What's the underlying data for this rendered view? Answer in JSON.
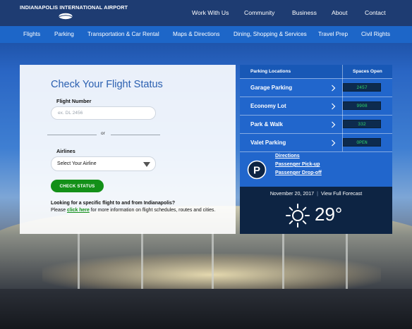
{
  "header": {
    "logo_text": "INDIANAPOLIS INTERNATIONAL AIRPORT",
    "nav": [
      "Work With Us",
      "Community",
      "Business",
      "About",
      "Contact"
    ]
  },
  "subnav": [
    "Flights",
    "Parking",
    "Transportation & Car Rental",
    "Maps & Directions",
    "Dining, Shopping & Services",
    "Travel Prep",
    "Civil Rights"
  ],
  "flight_status": {
    "title": "Check Your Flight Status",
    "flight_number_label": "Flight Number",
    "flight_number_placeholder": "ex. DL 2456",
    "flight_number_value": "",
    "or_text": "or",
    "airlines_label": "Airlines",
    "airline_selected": "Select Your Airline",
    "check_button": "CHECK STATUS",
    "note_heading": "Looking for a specific flight to and from Indianapolis?",
    "note_prefix": "Please ",
    "note_link": "click here",
    "note_suffix": " for more information on flight schedules, routes and cities."
  },
  "parking": {
    "col_locations": "Parking Locations",
    "col_spaces": "Spaces Open",
    "rows": [
      {
        "name": "Garage Parking",
        "spaces": "2457"
      },
      {
        "name": "Economy Lot",
        "spaces": "9908"
      },
      {
        "name": "Park & Walk",
        "spaces": "332"
      },
      {
        "name": "Valet Parking",
        "spaces": "OPEN"
      }
    ],
    "links": [
      "Directions",
      "Passenger Pick-up",
      "Passenger Drop-off"
    ],
    "icon": "parking-icon"
  },
  "weather": {
    "date": "November 20, 2017",
    "separator": "|",
    "forecast_link": "View Full Forecast",
    "temperature": "29°",
    "icon": "sun-icon"
  },
  "colors": {
    "topbar": "#1e3c72",
    "subnav": "#1d66c8",
    "accent_green": "#139018",
    "parking_blue": "#2166cc",
    "weather_dark": "#0d2443",
    "title_blue": "#2a5fb0",
    "led_green": "#2fd36a"
  }
}
